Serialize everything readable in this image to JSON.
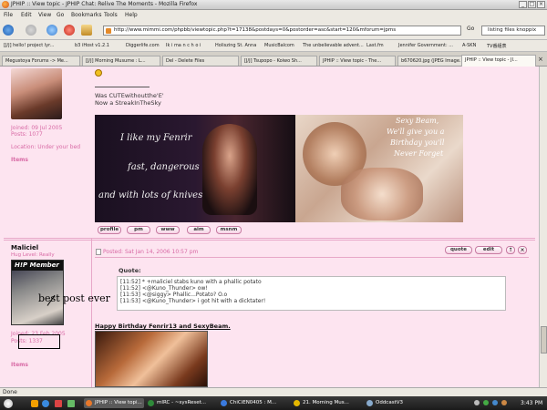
{
  "window": {
    "title": "JPHIP :: View topic - JPHIP Chat: Relive The Moments - Mozilla Firefox"
  },
  "menu": [
    "File",
    "Edit",
    "View",
    "Go",
    "Bookmarks",
    "Tools",
    "Help"
  ],
  "toolbar": {
    "url": "http://www.mimmi.com/phpbb/viewtopic.php?t=17138&postdays=0&postorder=asc&start=120&mforum=jpms",
    "go_label": "Go",
    "search_value": "listing files knoppix"
  },
  "bookmarks": [
    "[J/J] hello! project lyr...",
    "b3 iHost v1.2.1",
    "Diggerlife.com",
    "Ik i ma n c h o i",
    "Holiszing St. Anna",
    "MusicBalcom",
    "The unbelievable advent...",
    "Last.fm",
    "Jennifer Government: ...",
    "A-SKN",
    "TV番組表"
  ],
  "tabs": [
    "Megustoya Forums -> Me...",
    "[J/J] Morning Musume : L...",
    "Del - Delete Files",
    "[J/J] Tsupopo - Koiwo Sh...",
    "JPHIP :: View topic - The...",
    "b670620.jpg (JPEG Image...",
    "JPHIP :: View topic - JI..."
  ],
  "post1": {
    "joined": "Joined: 09 Jul 2005",
    "posts": "Posts: 1077",
    "location": "Location: Under your bed",
    "items": "Items",
    "sig_line1": "Was CUTEwithoutthe'E'",
    "sig_line2": "Now a StreakInTheSky",
    "banner_left_text": [
      "I like my Fenrir",
      "fast, dangerous",
      "and with lots of knives"
    ],
    "banner_right_text": [
      "Sexy Beam,",
      "We'll give you a",
      "Birthday you'll",
      "Never Forget"
    ],
    "buttons": [
      "profile",
      "pm",
      "www",
      "aim",
      "msnm"
    ]
  },
  "post2": {
    "username": "Maliciel",
    "rank": "Hug Level: Really",
    "avatar_label": "H!P Member",
    "joined": "Joined: 23 Feb 2005",
    "posts": "Posts: 1337",
    "items": "Items",
    "posted": "Posted: Sat Jan 14, 2006 10:57 pm",
    "quote_btn": "quote",
    "edit_btn": "edit",
    "quote_label": "Quote:",
    "quote_lines": [
      "[11:52] * +maliciel stabs kuno with a phallic potato",
      "[11:52] <@Kuno_Thunder> ow!",
      "[11:53] <@siggy> Phallic...Potato? O.o",
      "[11:53] <@Kuno_Thunder> i got hit with a dicktater!"
    ],
    "birthday": "Happy Birthday Fenrir13 and SexyBeam.",
    "annotation": "best post ever"
  },
  "status": "Done",
  "taskbar": {
    "items": [
      "JPHIP :: View topi...",
      "mIRC - ~sysReset...",
      "ChiCiEN0405 : M...",
      "21. Morning Mus...",
      "OddcastV3"
    ],
    "clock": "3:43 PM"
  },
  "colors": {
    "content_bg": "#fde4f0",
    "accent": "#d86aa5"
  }
}
